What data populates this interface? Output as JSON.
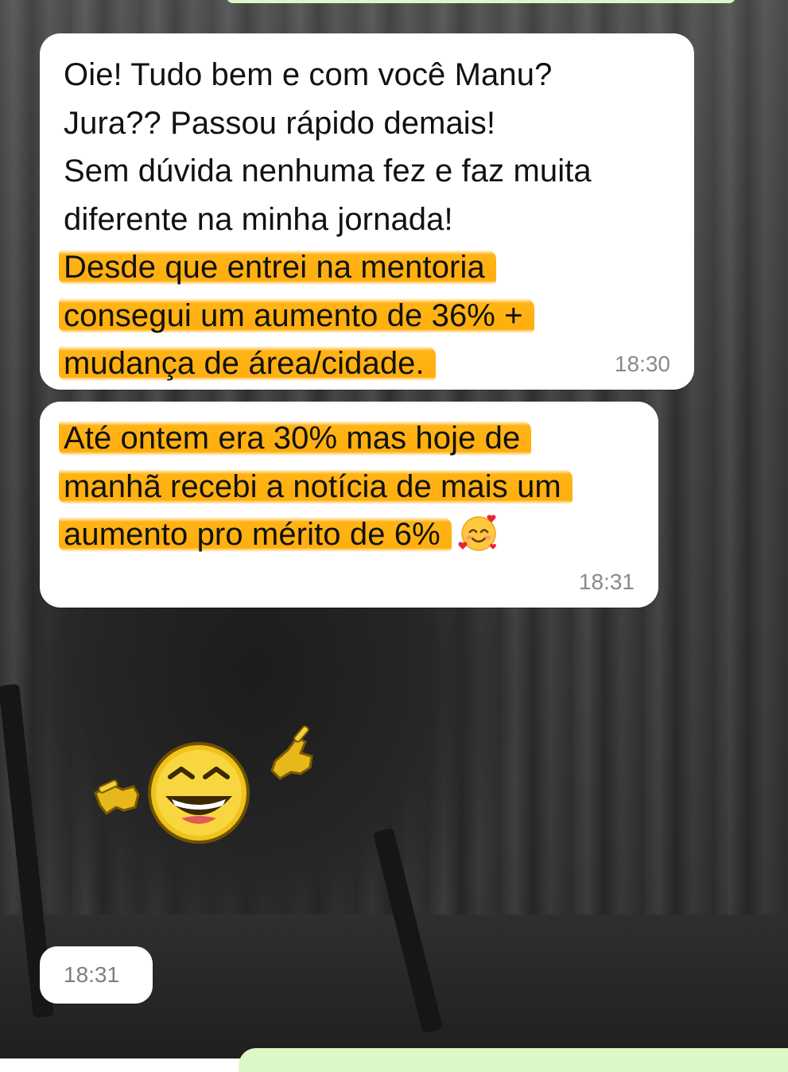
{
  "messages": [
    {
      "lines": [
        "Oie! Tudo bem e com você Manu?",
        "Jura?? Passou rápido demais!",
        "Sem dúvida nenhuma fez e faz muita",
        "diferente na minha jornada!"
      ],
      "highlighted_lines": [
        "Desde que entrei na mentoria",
        "consegui um aumento de 36% +",
        "mudança de área/cidade."
      ],
      "time": "18:30"
    },
    {
      "highlighted_lines": [
        "Até ontem era 30% mas hoje de",
        "manhã recebi a notícia de mais um",
        "aumento pro mérito de 6%"
      ],
      "emoji": "smiling-face-with-hearts-icon",
      "time": "18:31"
    },
    {
      "sticker": "laughing-pointing-smiley-sticker",
      "time": "18:31"
    }
  ],
  "colors": {
    "bubble": "#ffffff",
    "highlight": "#ffb000",
    "timestamp": "#8a8a8a",
    "outgoing": "#dcf8c6"
  }
}
